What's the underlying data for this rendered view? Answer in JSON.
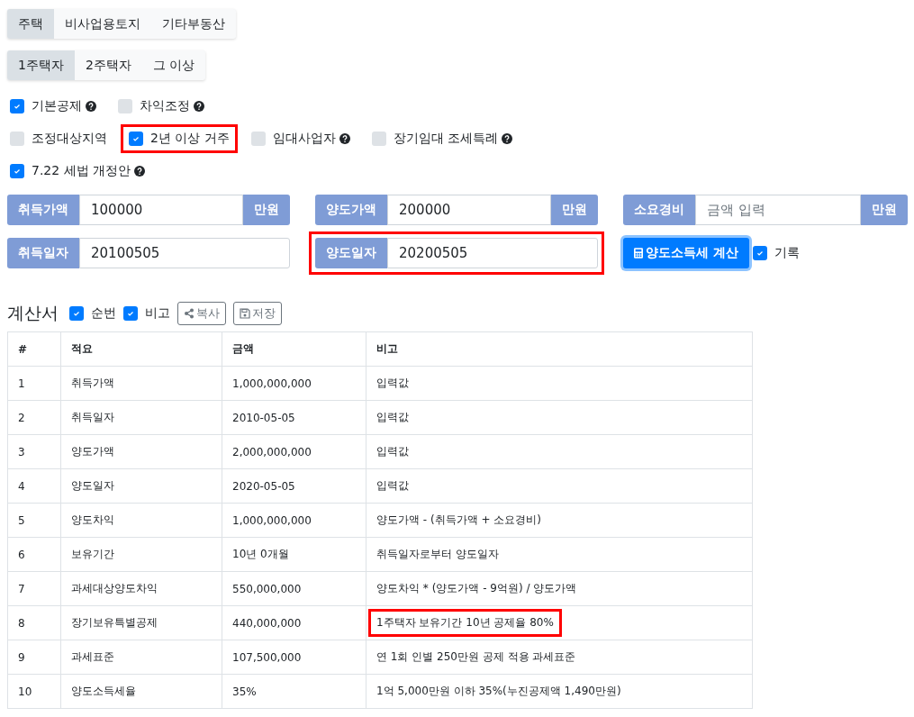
{
  "property_tabs": [
    {
      "label": "주택",
      "selected": true
    },
    {
      "label": "비사업용토지",
      "selected": false
    },
    {
      "label": "기타부동산",
      "selected": false
    }
  ],
  "owner_tabs": [
    {
      "label": "1주택자",
      "selected": true
    },
    {
      "label": "2주택자",
      "selected": false
    },
    {
      "label": "그 이상",
      "selected": false
    }
  ],
  "option_rows": [
    [
      {
        "label": "기본공제",
        "checked": true,
        "help": true,
        "highlighted": false
      },
      {
        "label": "차익조정",
        "checked": false,
        "help": true,
        "highlighted": false
      }
    ],
    [
      {
        "label": "조정대상지역",
        "checked": false,
        "help": false,
        "highlighted": false
      },
      {
        "label": "2년 이상 거주",
        "checked": true,
        "help": false,
        "highlighted": true
      },
      {
        "label": "임대사업자",
        "checked": false,
        "help": true,
        "highlighted": false
      },
      {
        "label": "장기임대 조세특례",
        "checked": false,
        "help": true,
        "highlighted": false
      }
    ],
    [
      {
        "label": "7.22 세법 개정안",
        "checked": true,
        "help": true,
        "highlighted": false
      }
    ]
  ],
  "fields": [
    {
      "label": "취득가액",
      "value": "100000",
      "unit": "만원",
      "highlighted": false
    },
    {
      "label": "양도가액",
      "value": "200000",
      "unit": "만원",
      "highlighted": false
    },
    {
      "label": "소요경비",
      "placeholder": "금액 입력",
      "unit": "만원",
      "highlighted": false
    },
    {
      "label": "취득일자",
      "value": "20100505",
      "highlighted": false
    },
    {
      "label": "양도일자",
      "value": "20200505",
      "highlighted": true
    }
  ],
  "calculate_button": "양도소득세 계산",
  "record_checkbox": {
    "label": "기록",
    "checked": true
  },
  "statement": {
    "title": "계산서",
    "toggles": [
      {
        "label": "순번",
        "checked": true
      },
      {
        "label": "비고",
        "checked": true
      }
    ],
    "buttons": [
      {
        "label": "복사",
        "kind": "share"
      },
      {
        "label": "저장",
        "kind": "save"
      }
    ],
    "columns": [
      "#",
      "적요",
      "금액",
      "비고"
    ],
    "rows": [
      {
        "cells": [
          "1",
          "취득가액",
          "1,000,000,000",
          "입력값"
        ],
        "highlighted": false
      },
      {
        "cells": [
          "2",
          "취득일자",
          "2010-05-05",
          "입력값"
        ],
        "highlighted": false
      },
      {
        "cells": [
          "3",
          "양도가액",
          "2,000,000,000",
          "입력값"
        ],
        "highlighted": false
      },
      {
        "cells": [
          "4",
          "양도일자",
          "2020-05-05",
          "입력값"
        ],
        "highlighted": false
      },
      {
        "cells": [
          "5",
          "양도차익",
          "1,000,000,000",
          "양도가액 - (취득가액 + 소요경비)"
        ],
        "highlighted": false
      },
      {
        "cells": [
          "6",
          "보유기간",
          "10년 0개월",
          "취득일자로부터 양도일자"
        ],
        "highlighted": false
      },
      {
        "cells": [
          "7",
          "과세대상양도차익",
          "550,000,000",
          "양도차익 * (양도가액 - 9억원) / 양도가액"
        ],
        "highlighted": false
      },
      {
        "cells": [
          "8",
          "장기보유특별공제",
          "440,000,000",
          "1주택자 보유기간 10년 공제율 80%"
        ],
        "highlighted": true
      },
      {
        "cells": [
          "9",
          "과세표준",
          "107,500,000",
          "연 1회 인별 250만원 공제 적용 과세표준"
        ],
        "highlighted": false
      },
      {
        "cells": [
          "10",
          "양도소득세율",
          "35%",
          "1억 5,000만원 이하 35%(누진공제액 1,490만원)"
        ],
        "highlighted": false
      }
    ]
  }
}
